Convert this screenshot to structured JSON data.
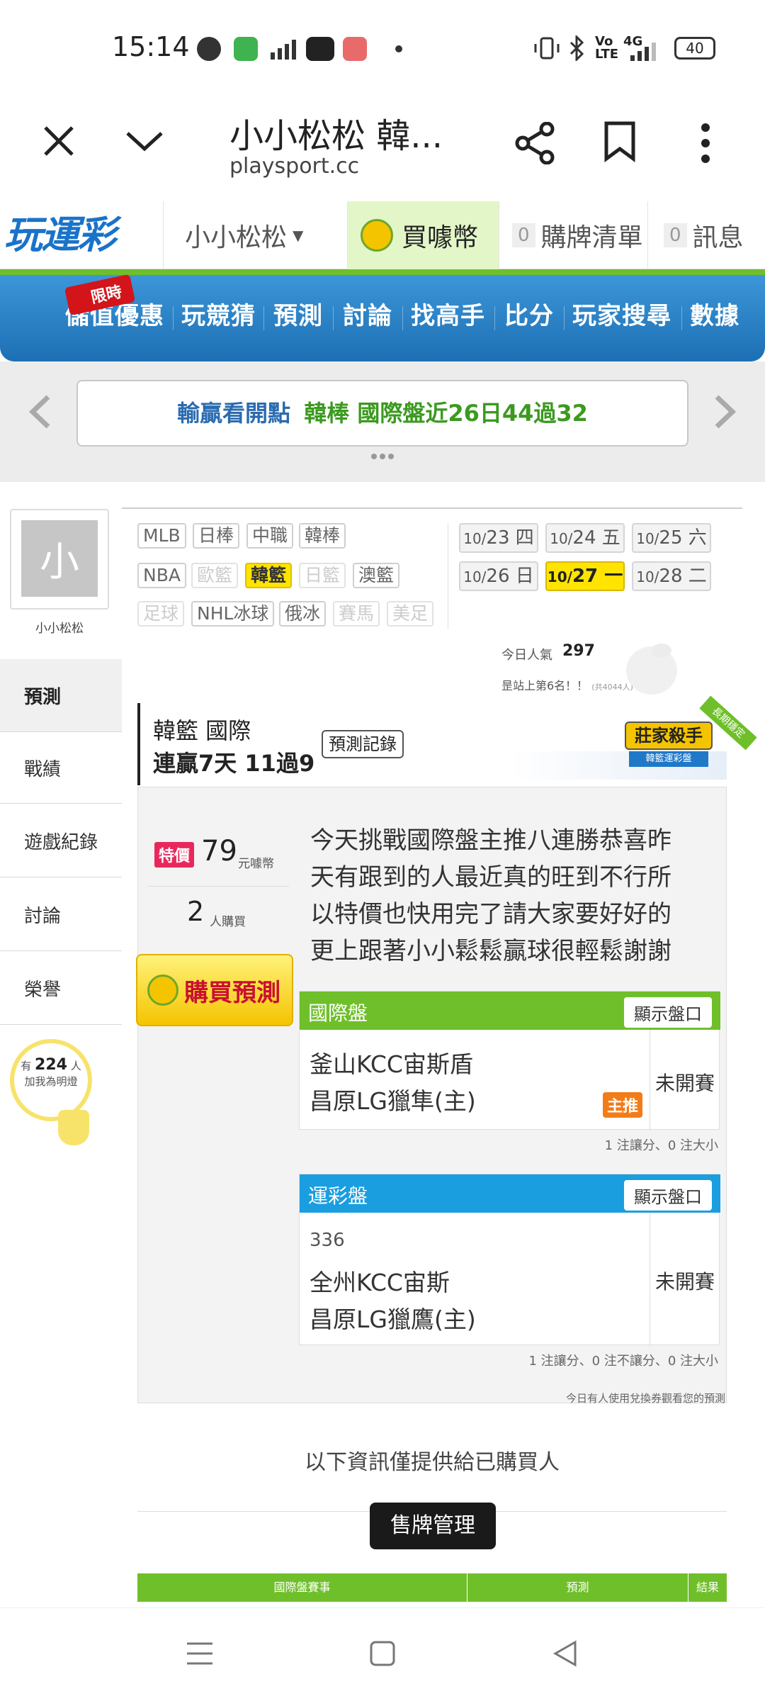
{
  "status": {
    "time": "15:14",
    "battery": "40",
    "network": "4G"
  },
  "browser": {
    "title": "小小松松 韓...",
    "url": "playsport.cc"
  },
  "site": {
    "logo": "玩運彩",
    "user_menu": "小小松松",
    "buy_coins": "買噱幣",
    "cart_count": "0",
    "cart_label": "購牌清單",
    "msg_count": "0",
    "msg_label": "訊息"
  },
  "nav": {
    "badge": "限時",
    "items": [
      "儲值優惠",
      "玩競猜",
      "預測",
      "討論",
      "找高手",
      "比分",
      "玩家搜尋",
      "數據"
    ]
  },
  "banner": {
    "prefix": "輸贏看開點",
    "text": "韓棒 國際盤近26日44過32"
  },
  "profile": {
    "avatar_char": "小",
    "name": "小小松松"
  },
  "sidebar": {
    "items": [
      "預測",
      "戰績",
      "遊戲紀錄",
      "討論",
      "榮譽"
    ]
  },
  "lamp": {
    "prefix": "有",
    "count": "224",
    "unit": "人",
    "label": "加我為明燈"
  },
  "sports": {
    "row1": [
      "MLB",
      "日棒",
      "中職",
      "韓棒"
    ],
    "row2": [
      "NBA",
      "歐籃",
      "韓籃",
      "日籃",
      "澳籃"
    ],
    "row3": [
      "足球",
      "NHL冰球",
      "俄冰",
      "賽馬",
      "美足"
    ]
  },
  "dates": [
    {
      "md": "10/",
      "day": "23",
      "wd": "四"
    },
    {
      "md": "10/",
      "day": "24",
      "wd": "五"
    },
    {
      "md": "10/",
      "day": "25",
      "wd": "六"
    },
    {
      "md": "10/",
      "day": "26",
      "wd": "日"
    },
    {
      "md": "10/",
      "day": "27",
      "wd": "一"
    },
    {
      "md": "10/",
      "day": "28",
      "wd": "二"
    }
  ],
  "popularity": {
    "label": "今日人氣",
    "value": "297",
    "rank": "昰站上第6名！！",
    "total": "(共4044人)"
  },
  "record": {
    "league": "韓籃 國際",
    "streak": "連贏7天 11過9",
    "history_btn": "預測記錄",
    "badge_title": "莊家殺手",
    "badge_sub": "韓籃運彩盤",
    "ribbon": "長期穩定"
  },
  "price": {
    "tag": "特價",
    "value": "79",
    "unit": "元噱幣",
    "buyers": "2",
    "buyers_label": "人購買",
    "buy_btn": "購買預測"
  },
  "message": "今天挑戰國際盤主推八連勝恭喜昨天有跟到的人最近真的旺到不行所以特價也快用完了請大家要好好的更上跟著小小鬆鬆贏球很輕鬆謝謝",
  "intl_box": {
    "title": "國際盤",
    "show_btn": "顯示盤口",
    "team1": "釜山KCC宙斯盾",
    "team2": "昌原LG獵隼(主)",
    "main_tag": "主推",
    "status": "未開賽",
    "note": "1 注讓分、0 注大小"
  },
  "lottery_box": {
    "title": "運彩盤",
    "show_btn": "顯示盤口",
    "number": "336",
    "team1": "全州KCC宙斯",
    "team2": "昌原LG獵鷹(主)",
    "status": "未開賽",
    "note": "1 注讓分、0 注不讓分、0 注大小"
  },
  "exchange_note": "今日有人使用兌換券觀看您的預測",
  "buyer_only": "以下資訊僅提供給已購買人",
  "manage_btn": "售牌管理",
  "table_header": {
    "col1": "國際盤賽事",
    "col2": "預測",
    "col3": "結果"
  },
  "colors": {
    "green": "#6fbf2a",
    "blue": "#1a9ee0",
    "yellow": "#ffe400",
    "nav_blue": "#2b82c8"
  }
}
